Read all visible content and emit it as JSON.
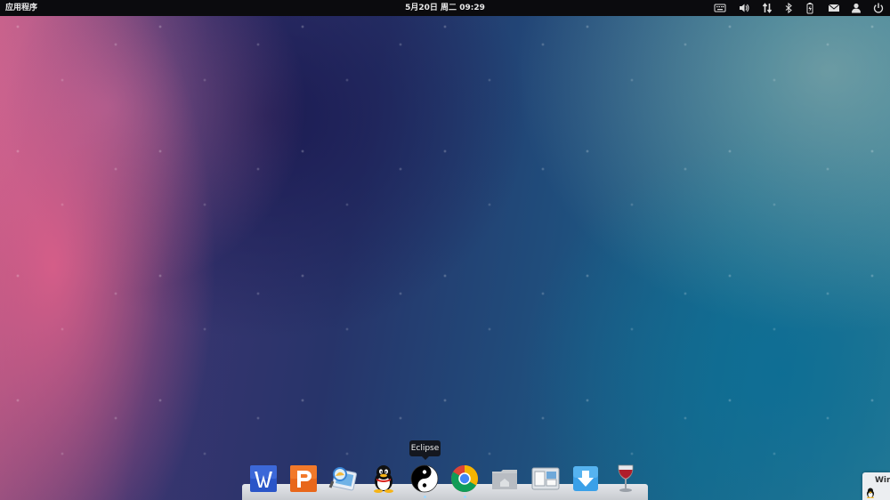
{
  "top_panel": {
    "applications_label": "应用程序",
    "clock_text": "5月20日 周二 09:29",
    "indicators": [
      {
        "name": "keyboard-icon"
      },
      {
        "name": "volume-icon"
      },
      {
        "name": "network-icon"
      },
      {
        "name": "bluetooth-icon"
      },
      {
        "name": "battery-icon"
      },
      {
        "name": "mail-icon"
      },
      {
        "name": "user-icon"
      },
      {
        "name": "power-icon"
      }
    ]
  },
  "dock": {
    "items": [
      {
        "name": "wps-writer-icon",
        "color": "#2a55c8"
      },
      {
        "name": "wps-presentation-icon",
        "color": "#e8671b"
      },
      {
        "name": "image-viewer-icon",
        "color": "#3a86d6"
      },
      {
        "name": "qq-penguin-icon",
        "color": "#111111"
      },
      {
        "name": "eclipse-yin-yang-icon",
        "color": "#000000"
      },
      {
        "name": "chrome-icon",
        "color": "#db4437"
      },
      {
        "name": "home-folder-icon",
        "color": "#b8bcc2"
      },
      {
        "name": "workspace-switcher-icon",
        "color": "#6fa8d9"
      },
      {
        "name": "download-icon",
        "color": "#3aa0e8"
      },
      {
        "name": "wine-glass-icon",
        "color": "#b01e2a"
      }
    ],
    "tooltip": "Eclipse"
  },
  "window_peek": {
    "label": "Win"
  },
  "colors": {
    "panel_bg": "#0b0b0e",
    "panel_text": "#e8e8e8",
    "dock_shelf": "#d8dadf"
  }
}
